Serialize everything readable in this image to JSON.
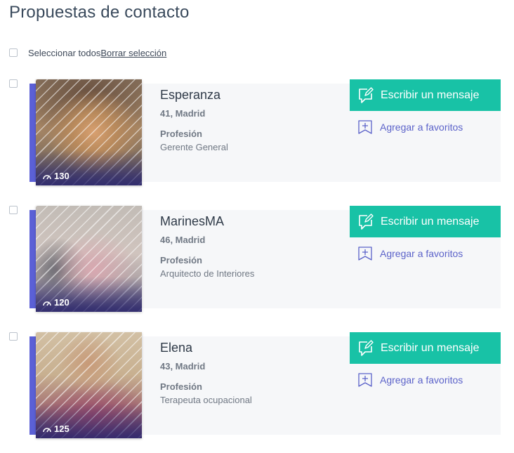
{
  "page": {
    "title": "Propuestas de contacto"
  },
  "selection": {
    "select_all_label": "Seleccionar todos",
    "clear_label": "Borrar selección"
  },
  "colors": {
    "accent": "#5b60d6",
    "button": "#18c2a6",
    "link": "#5b62c9",
    "card_bg": "#f6f7f9"
  },
  "profiles": [
    {
      "name": "Esperanza",
      "age_city": "41, Madrid",
      "profession_label": "Profesión",
      "profession": "Gerente General",
      "views": "130",
      "message_label": "Escribir un mensaje",
      "favorite_label": "Agregar a favoritos"
    },
    {
      "name": "MarinesMA",
      "age_city": "46, Madrid",
      "profession_label": "Profesión",
      "profession": "Arquitecto de Interiores",
      "views": "120",
      "message_label": "Escribir un mensaje",
      "favorite_label": "Agregar a favoritos"
    },
    {
      "name": "Elena",
      "age_city": "43, Madrid",
      "profession_label": "Profesión",
      "profession": "Terapeuta ocupacional",
      "views": "125",
      "message_label": "Escribir un mensaje",
      "favorite_label": "Agregar a favoritos"
    }
  ]
}
